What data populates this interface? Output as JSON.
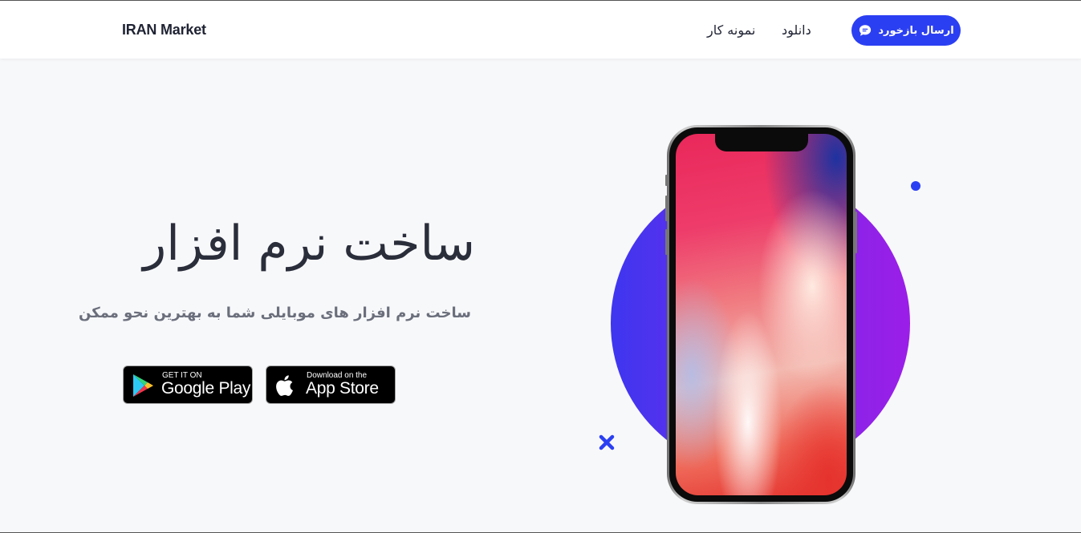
{
  "header": {
    "brand": "IRAN Market",
    "nav": {
      "samples": "نمونه کار",
      "download": "دانلود"
    },
    "feedback_button": "ارسال بازخورد"
  },
  "hero": {
    "title": "ساخت نرم افزار",
    "subtitle": "ساخت نرم افزار های موبایلی شما به بهترین نحو ممکن",
    "google_play": {
      "small": "GET IT ON",
      "big": "Google Play"
    },
    "app_store": {
      "small": "Download on the",
      "big": "App Store"
    }
  },
  "colors": {
    "accent": "#2b3ff2",
    "circle_start": "#3e36f0",
    "circle_end": "#9b1ee8",
    "background": "#f7f8fa"
  },
  "icons": [
    "chat-icon",
    "google-play-icon",
    "apple-icon",
    "cross-icon"
  ]
}
